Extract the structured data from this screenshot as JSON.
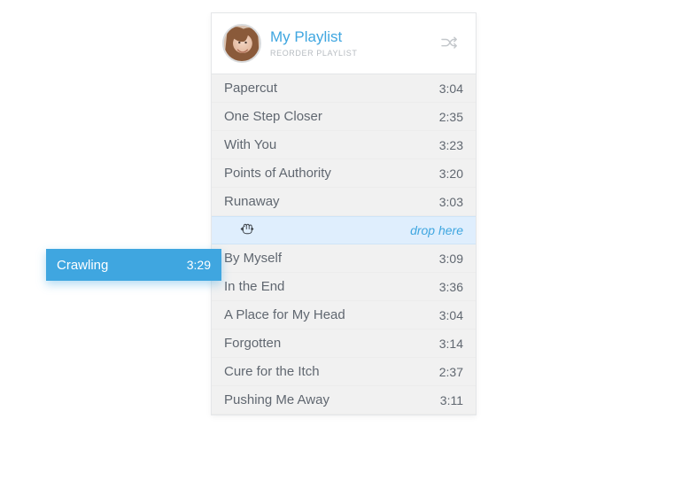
{
  "header": {
    "title": "My Playlist",
    "subtitle": "REORDER PLAYLIST"
  },
  "drop_label": "drop here",
  "dragging": {
    "title": "Crawling",
    "time": "3:29"
  },
  "tracks": [
    {
      "title": "Papercut",
      "time": "3:04"
    },
    {
      "title": "One Step Closer",
      "time": "2:35"
    },
    {
      "title": "With You",
      "time": "3:23"
    },
    {
      "title": "Points of Authority",
      "time": "3:20"
    },
    {
      "title": "Runaway",
      "time": "3:03"
    },
    {
      "title": "By Myself",
      "time": "3:09"
    },
    {
      "title": "In the End",
      "time": "3:36"
    },
    {
      "title": "A Place for My Head",
      "time": "3:04"
    },
    {
      "title": "Forgotten",
      "time": "3:14"
    },
    {
      "title": "Cure for the Itch",
      "time": "2:37"
    },
    {
      "title": "Pushing Me Away",
      "time": "3:11"
    }
  ]
}
